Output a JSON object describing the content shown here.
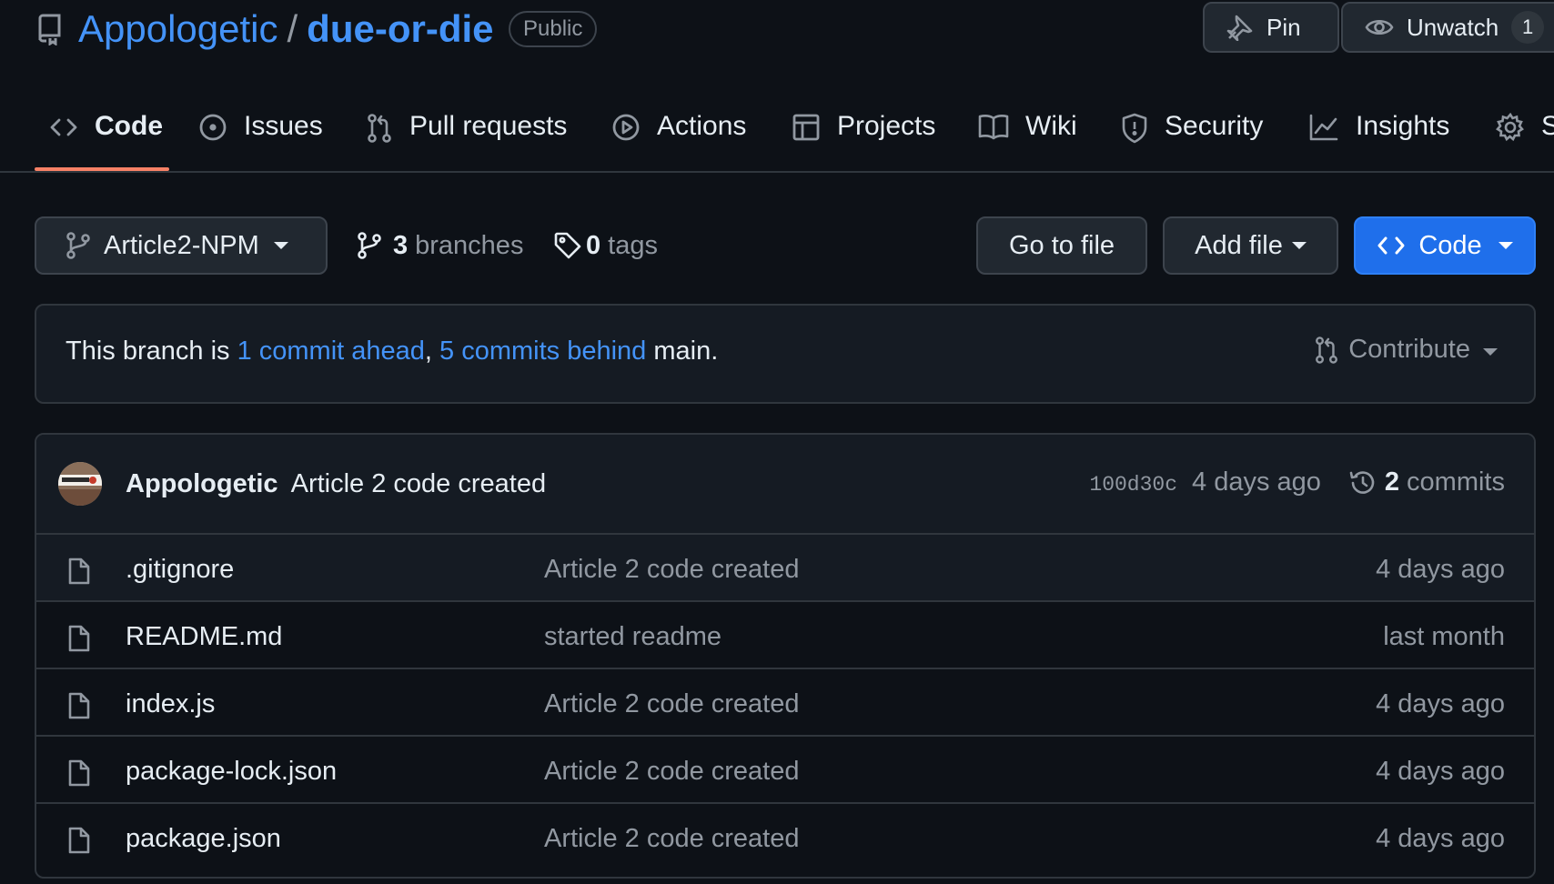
{
  "repo": {
    "owner": "Appologetic",
    "separator": "/",
    "name": "due-or-die",
    "visibility": "Public"
  },
  "header_actions": {
    "pin_label": "Pin",
    "watch_label": "Unwatch",
    "watch_count": "1"
  },
  "tabs": [
    {
      "label": "Code",
      "icon": "code-icon",
      "active": true
    },
    {
      "label": "Issues",
      "icon": "issue-icon"
    },
    {
      "label": "Pull requests",
      "icon": "pull-request-icon"
    },
    {
      "label": "Actions",
      "icon": "play-icon"
    },
    {
      "label": "Projects",
      "icon": "table-icon"
    },
    {
      "label": "Wiki",
      "icon": "book-icon"
    },
    {
      "label": "Security",
      "icon": "shield-icon"
    },
    {
      "label": "Insights",
      "icon": "graph-icon"
    },
    {
      "label": "S",
      "icon": "gear-icon"
    }
  ],
  "toolbar": {
    "branch": "Article2-NPM",
    "branches_count": "3",
    "branches_label": "branches",
    "tags_count": "0",
    "tags_label": "tags",
    "go_to_file": "Go to file",
    "add_file": "Add file",
    "code_button": "Code"
  },
  "branch_status": {
    "prefix": "This branch is ",
    "ahead": "1 commit ahead",
    "comma": ", ",
    "behind": "5 commits behind",
    "suffix": " main.",
    "contribute": "Contribute"
  },
  "latest_commit": {
    "author": "Appologetic",
    "message": "Article 2 code created",
    "sha": "100d30c",
    "age": "4 days ago",
    "commits_count": "2",
    "commits_label": "commits"
  },
  "files": [
    {
      "name": ".gitignore",
      "commit": "Article 2 code created",
      "age": "4 days ago"
    },
    {
      "name": "README.md",
      "commit": "started readme",
      "age": "last month"
    },
    {
      "name": "index.js",
      "commit": "Article 2 code created",
      "age": "4 days ago"
    },
    {
      "name": "package-lock.json",
      "commit": "Article 2 code created",
      "age": "4 days ago"
    },
    {
      "name": "package.json",
      "commit": "Article 2 code created",
      "age": "4 days ago"
    }
  ],
  "colors": {
    "background": "#0d1117",
    "link": "#4493f8",
    "primary_button": "#1f6feb",
    "tab_underline": "#f78166"
  }
}
